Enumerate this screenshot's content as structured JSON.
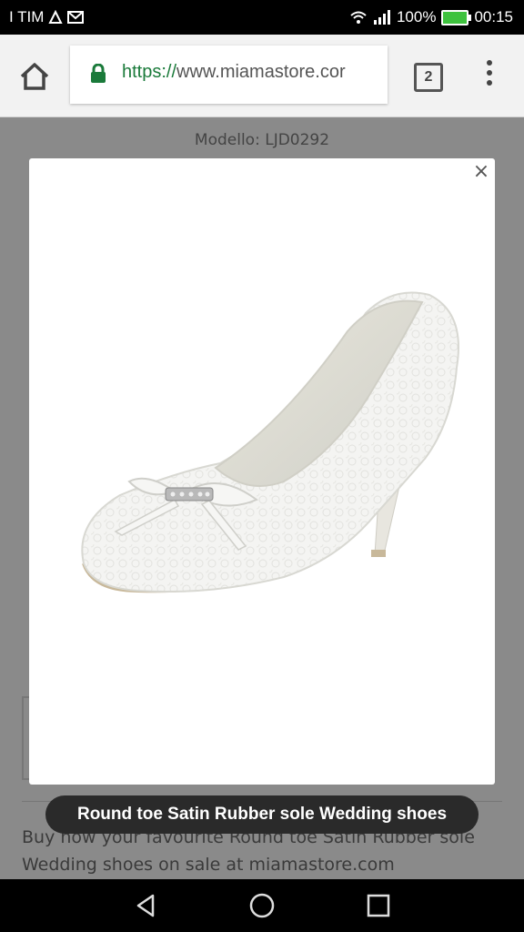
{
  "status_bar": {
    "carrier": "I TIM",
    "battery_percent": "100%",
    "time": "00:15",
    "icons": [
      "sim-icon",
      "image-icon",
      "mail-icon",
      "wifi-icon",
      "signal-icon",
      "battery-charging-icon"
    ]
  },
  "browser": {
    "url_scheme": "https://",
    "url_host": "www.miamastore.cor",
    "tab_count": "2",
    "icons": [
      "home-icon",
      "lock-icon",
      "more-vert-icon"
    ]
  },
  "page": {
    "model_label": "Modello: LJD0292",
    "description": "Buy now your favourite Round toe Satin Rubber sole Wedding shoes on sale at miamastore.com"
  },
  "modal": {
    "close_label": "×",
    "image_alt": "white lace wedding pump shoe"
  },
  "toast": {
    "text": "Round toe Satin Rubber sole Wedding shoes"
  },
  "nav": {
    "icons": [
      "back-icon",
      "home-circle-icon",
      "recents-icon"
    ]
  }
}
